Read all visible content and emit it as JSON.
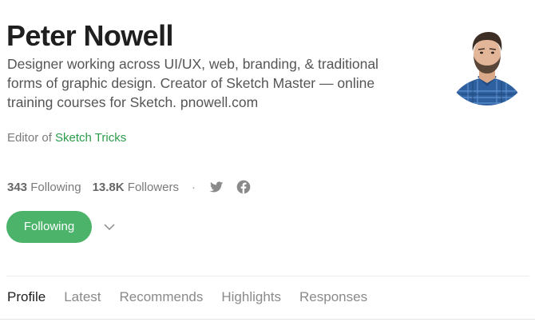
{
  "profile": {
    "name": "Peter Nowell",
    "bio": "Designer working across UI/UX, web, branding, & traditional forms of graphic design. Creator of Sketch Master — online training courses for Sketch. pnowell.com",
    "editor_prefix": "Editor of ",
    "editor_publication": "Sketch Tricks"
  },
  "stats": {
    "following_count": "343",
    "following_label": "Following",
    "followers_count": "13.8K",
    "followers_label": "Followers",
    "separator": "·",
    "social_icons": [
      "twitter-icon",
      "facebook-icon"
    ]
  },
  "actions": {
    "follow_label": "Following",
    "more_icon": "chevron-down-icon"
  },
  "tabs": [
    {
      "label": "Profile",
      "active": true
    },
    {
      "label": "Latest",
      "active": false
    },
    {
      "label": "Recommends",
      "active": false
    },
    {
      "label": "Highlights",
      "active": false
    },
    {
      "label": "Responses",
      "active": false
    }
  ],
  "colors": {
    "accent_green": "#4bb36a",
    "link_green": "#2a9d4b",
    "text_dark": "#1f1f1f",
    "text_muted": "#7a7a7a"
  }
}
